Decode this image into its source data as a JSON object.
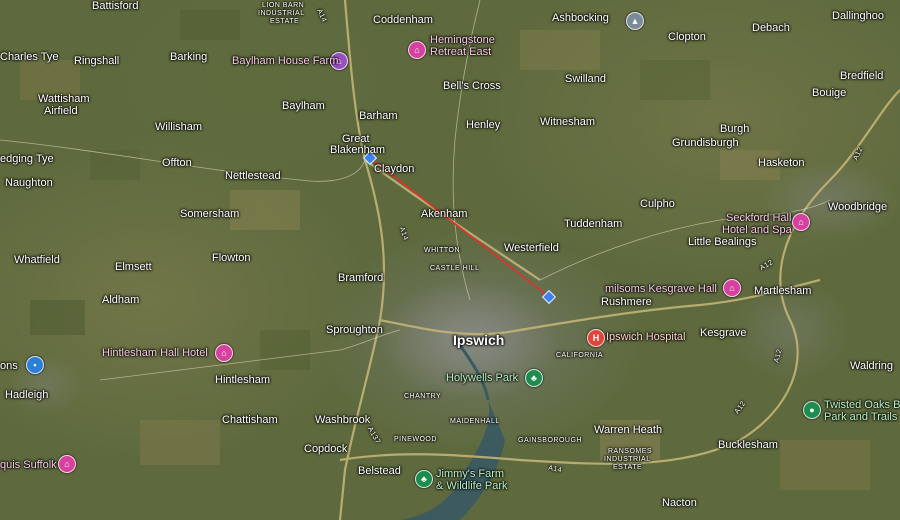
{
  "map": {
    "places": [
      {
        "id": "battisford",
        "text": "Battisford"
      },
      {
        "id": "coddenham",
        "text": "Coddenham"
      },
      {
        "id": "ashbocking",
        "text": "Ashbocking"
      },
      {
        "id": "debach",
        "text": "Debach"
      },
      {
        "id": "dallinghoo",
        "text": "Dallinghoo"
      },
      {
        "id": "charles-tye",
        "text": "Charles Tye"
      },
      {
        "id": "ringshall",
        "text": "Ringshall"
      },
      {
        "id": "barking",
        "text": "Barking"
      },
      {
        "id": "clopton",
        "text": "Clopton"
      },
      {
        "id": "bredfield",
        "text": "Bredfield"
      },
      {
        "id": "bells-cross",
        "text": "Bell's Cross"
      },
      {
        "id": "swilland",
        "text": "Swilland"
      },
      {
        "id": "bouige",
        "text": "Bouige"
      },
      {
        "id": "wattisham",
        "text": "Wattisham"
      },
      {
        "id": "airfield",
        "text": "Airfield"
      },
      {
        "id": "baylham",
        "text": "Baylham"
      },
      {
        "id": "barham",
        "text": "Barham"
      },
      {
        "id": "willisham",
        "text": "Willisham"
      },
      {
        "id": "henley",
        "text": "Henley"
      },
      {
        "id": "witnesham",
        "text": "Witnesham"
      },
      {
        "id": "burgh",
        "text": "Burgh"
      },
      {
        "id": "great",
        "text": "Great"
      },
      {
        "id": "blakenham",
        "text": "Blakenham"
      },
      {
        "id": "grundisburgh",
        "text": "Grundisburgh"
      },
      {
        "id": "edging-tye",
        "text": "edging Tye"
      },
      {
        "id": "offton",
        "text": "Offton"
      },
      {
        "id": "claydon",
        "text": "Claydon"
      },
      {
        "id": "hasketon",
        "text": "Hasketon"
      },
      {
        "id": "nettlestead",
        "text": "Nettlestead"
      },
      {
        "id": "naughton",
        "text": "Naughton"
      },
      {
        "id": "somersham",
        "text": "Somersham"
      },
      {
        "id": "akenham",
        "text": "Akenham"
      },
      {
        "id": "culpho",
        "text": "Culpho"
      },
      {
        "id": "woodbridge",
        "text": "Woodbridge"
      },
      {
        "id": "tuddenham",
        "text": "Tuddenham"
      },
      {
        "id": "whitton",
        "text": "WHITTON"
      },
      {
        "id": "westerfield",
        "text": "Westerfield"
      },
      {
        "id": "little-bealings",
        "text": "Little Bealings"
      },
      {
        "id": "whatfield",
        "text": "Whatfield"
      },
      {
        "id": "flowton",
        "text": "Flowton"
      },
      {
        "id": "elmsett",
        "text": "Elmsett"
      },
      {
        "id": "castle-hill",
        "text": "CASTLE HILL"
      },
      {
        "id": "bramford",
        "text": "Bramford"
      },
      {
        "id": "rushmere",
        "text": "Rushmere"
      },
      {
        "id": "martlesham",
        "text": "Martlesham"
      },
      {
        "id": "aldham",
        "text": "Aldham"
      },
      {
        "id": "sproughton",
        "text": "Sproughton"
      },
      {
        "id": "kesgrave",
        "text": "Kesgrave"
      },
      {
        "id": "ipswich",
        "text": "Ipswich"
      },
      {
        "id": "california",
        "text": "CALIFORNIA"
      },
      {
        "id": "waldring",
        "text": "Waldring"
      },
      {
        "id": "hintlesham",
        "text": "Hintlesham"
      },
      {
        "id": "hadleigh",
        "text": "Hadleigh"
      },
      {
        "id": "chantry",
        "text": "CHANTRY"
      },
      {
        "id": "washbrook",
        "text": "Washbrook"
      },
      {
        "id": "maidenhall",
        "text": "MAIDENHALL"
      },
      {
        "id": "chattisham",
        "text": "Chattisham"
      },
      {
        "id": "warren-heath",
        "text": "Warren Heath"
      },
      {
        "id": "bucklesham",
        "text": "Bucklesham"
      },
      {
        "id": "copdock",
        "text": "Copdock"
      },
      {
        "id": "pinewood",
        "text": "PINEWOOD"
      },
      {
        "id": "gainsborough",
        "text": "GAINSBOROUGH"
      },
      {
        "id": "ransomes",
        "text": "RANSOMES"
      },
      {
        "id": "industrial",
        "text": "INDUSTRIAL"
      },
      {
        "id": "estate",
        "text": "ESTATE"
      },
      {
        "id": "belstead",
        "text": "Belstead"
      },
      {
        "id": "nacton",
        "text": "Nacton"
      },
      {
        "id": "lion-barn-1",
        "text": "LION BARN"
      },
      {
        "id": "lion-barn-2",
        "text": "INDUSTRIAL"
      },
      {
        "id": "lion-barn-3",
        "text": "ESTATE"
      },
      {
        "id": "ons",
        "text": "ons"
      }
    ],
    "pois": [
      {
        "id": "hemingstone",
        "line1": "Hemingstone",
        "line2": "Retreat East",
        "icon": "hotel-icon"
      },
      {
        "id": "baylham-house",
        "line1": "Baylham House Farm",
        "line2": "",
        "icon": "hotel-icon"
      },
      {
        "id": "seckford",
        "line1": "Seckford Hall",
        "line2": "Hotel and Spa",
        "icon": "hotel-icon"
      },
      {
        "id": "milsoms",
        "line1": "milsoms Kesgrave Hall",
        "line2": "",
        "icon": "hotel-icon"
      },
      {
        "id": "ipswich-hospital",
        "line1": "Ipswich Hospital",
        "line2": "",
        "icon": "hospital-icon"
      },
      {
        "id": "hintlesham-hall",
        "line1": "Hintlesham Hall Hotel",
        "line2": "",
        "icon": "hotel-icon"
      },
      {
        "id": "holywells",
        "line1": "Holywells Park",
        "line2": "",
        "icon": "park-icon"
      },
      {
        "id": "twisted-oaks",
        "line1": "Twisted Oaks B",
        "line2": "Park and Trails",
        "icon": "park-icon"
      },
      {
        "id": "jimmys",
        "line1": "Jimmy's Farm",
        "line2": "& Wildlife Park",
        "icon": "park-icon"
      },
      {
        "id": "quis",
        "line1": "quis Suffolk",
        "line2": "",
        "icon": "hotel-icon"
      }
    ],
    "road_labels": [
      "A14",
      "A14",
      "A14",
      "A12",
      "A12",
      "A12",
      "A12",
      "A137"
    ],
    "route": {
      "from": "Claydon",
      "to": "Westerfield",
      "color": "#e03030"
    },
    "colors": {
      "hotel": "#d6409f",
      "park": "#1e8c4e",
      "hospital": "#e0443a",
      "shop": "#2b7fd6",
      "campus": "#7b8b99"
    }
  }
}
